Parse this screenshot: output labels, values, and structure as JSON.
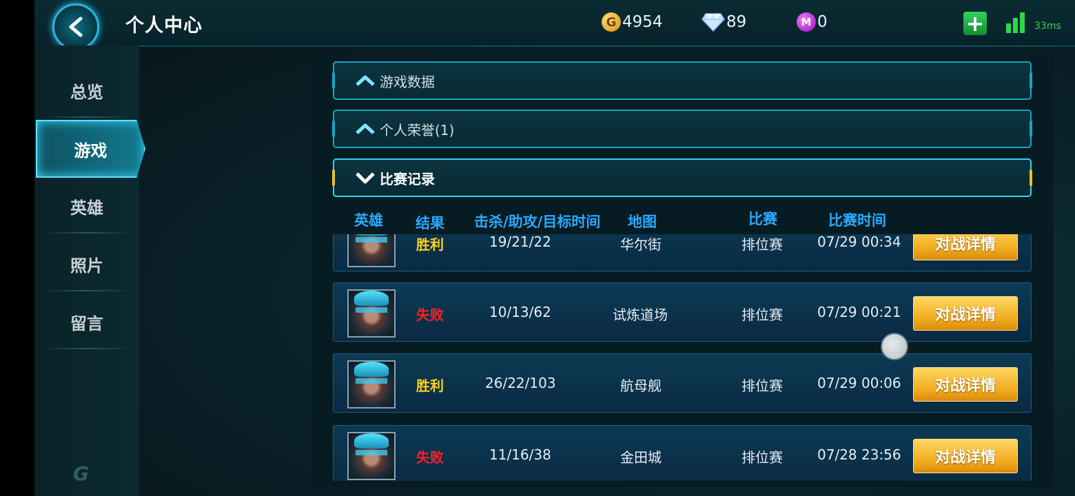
{
  "header": {
    "title": "个人中心",
    "gold": "4954",
    "diamonds": "89",
    "tokens": "0",
    "coin_symbol": "G",
    "token_symbol": "M",
    "ping": "33ms",
    "accent_color": "#1ec8ff"
  },
  "sidebar": {
    "items": [
      {
        "label": "总览",
        "active": false
      },
      {
        "label": "游戏",
        "active": true
      },
      {
        "label": "英雄",
        "active": false
      },
      {
        "label": "照片",
        "active": false
      },
      {
        "label": "留言",
        "active": false
      }
    ],
    "logo": "G"
  },
  "sections": [
    {
      "label": "游戏数据",
      "state": "collapsed"
    },
    {
      "label": "个人荣誉(1)",
      "state": "collapsed"
    },
    {
      "label": "比赛记录",
      "state": "expanded"
    }
  ],
  "columns": {
    "hero": "英雄",
    "result": "结果",
    "kda": "击杀/助攻/目标时间",
    "map": "地图",
    "match": "比赛",
    "time": "比赛时间"
  },
  "records": [
    {
      "result": "胜利",
      "outcome": "win",
      "kda": "19/21/22",
      "map": "华尔街",
      "match": "排位赛",
      "time": "07/29 00:34",
      "button": "对战详情"
    },
    {
      "result": "失败",
      "outcome": "lose",
      "kda": "10/13/62",
      "map": "试炼道场",
      "match": "排位赛",
      "time": "07/29 00:21",
      "button": "对战详情"
    },
    {
      "result": "胜利",
      "outcome": "win",
      "kda": "26/22/103",
      "map": "航母舰",
      "match": "排位赛",
      "time": "07/29 00:06",
      "button": "对战详情"
    },
    {
      "result": "失败",
      "outcome": "lose",
      "kda": "11/16/38",
      "map": "金田城",
      "match": "排位赛",
      "time": "07/28 23:56",
      "button": "对战详情"
    }
  ]
}
